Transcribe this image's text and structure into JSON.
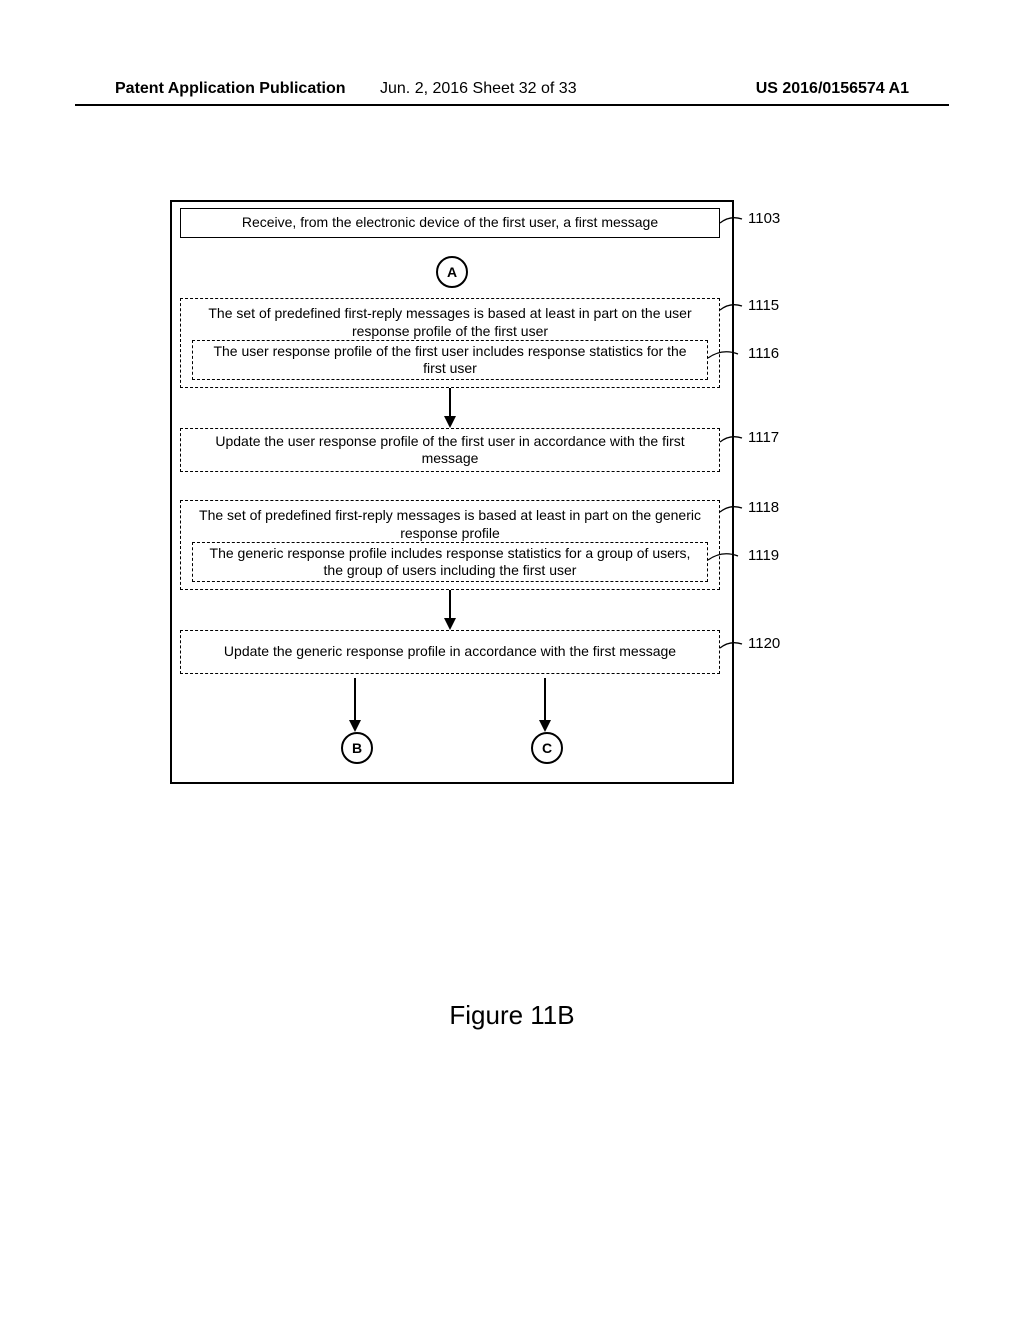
{
  "header": {
    "left": "Patent Application Publication",
    "mid": "Jun. 2, 2016   Sheet 32 of 33",
    "right": "US 2016/0156574 A1"
  },
  "figure_label": "Figure 11B",
  "steps": {
    "s1103": "Receive, from the electronic device of the first user, a first message",
    "s1115": "The set of predefined first-reply messages is based at least in part on the user response profile of the first user",
    "s1116": "The user response profile of the first user includes response statistics for the first user",
    "s1117": "Update the user response profile of the first user in accordance with the first message",
    "s1118": "The set of predefined first-reply messages is based at least in part on the generic response profile",
    "s1119": "The generic response profile includes response statistics for a group of users, the group of users including the first user",
    "s1120": "Update the generic response profile in accordance with the first message"
  },
  "refs": {
    "r1103": "1103",
    "r1115": "1115",
    "r1116": "1116",
    "r1117": "1117",
    "r1118": "1118",
    "r1119": "1119",
    "r1120": "1120"
  },
  "connectors": {
    "A": "A",
    "B": "B",
    "C": "C"
  }
}
